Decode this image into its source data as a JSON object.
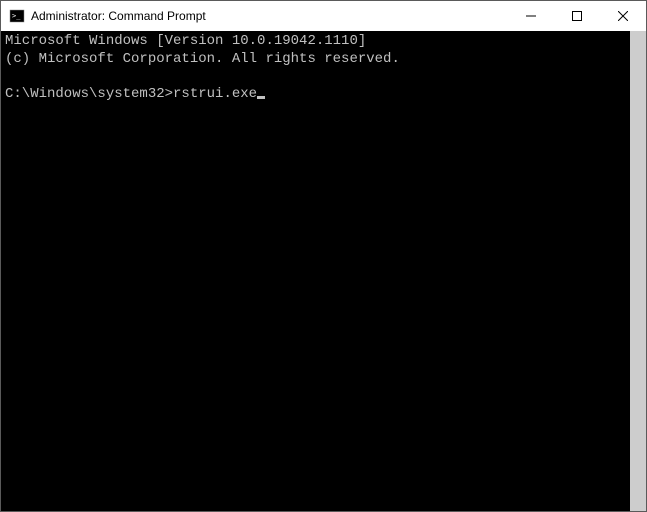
{
  "window": {
    "title": "Administrator: Command Prompt"
  },
  "terminal": {
    "line1": "Microsoft Windows [Version 10.0.19042.1110]",
    "line2": "(c) Microsoft Corporation. All rights reserved.",
    "blank": "",
    "prompt": "C:\\Windows\\system32>",
    "command": "rstrui.exe"
  }
}
